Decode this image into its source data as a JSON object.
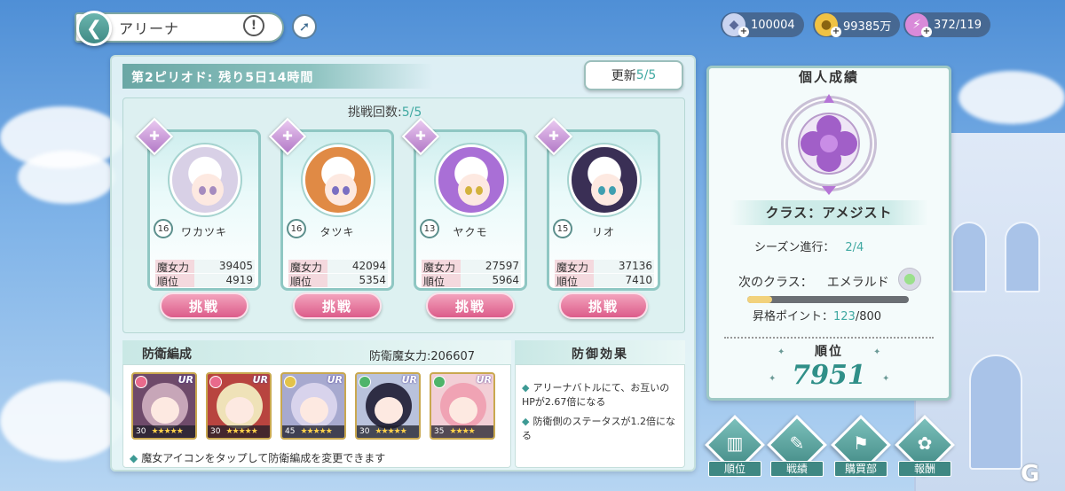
{
  "header": {
    "title": "アリーナ",
    "help_glyph": "!",
    "compass_glyph": "➚",
    "back_glyph": "❮"
  },
  "currencies": [
    {
      "name": "diamond-icon",
      "value": "100004",
      "color": "#c9d4f0"
    },
    {
      "name": "coin-icon",
      "value": "99385万",
      "color": "#f0c244"
    },
    {
      "name": "stamina-icon",
      "value": "372/119",
      "color": "#d98ad9"
    }
  ],
  "period": {
    "label": "第2ピリオド: 残り5日14時間"
  },
  "refresh": {
    "label": "更新",
    "count": "5/5"
  },
  "challenges": {
    "label": "挑戦回数:",
    "count": "5/5"
  },
  "opponents": [
    {
      "level": "16",
      "name": "ワカツキ",
      "power_label": "魔女力",
      "power": "39405",
      "rank_label": "順位",
      "rank": "4919",
      "hair": "#d8d0e6",
      "eye": "#a58bbf"
    },
    {
      "level": "16",
      "name": "タツキ",
      "power_label": "魔女力",
      "power": "42094",
      "rank_label": "順位",
      "rank": "5354",
      "hair": "#e08a45",
      "eye": "#7a6fc2"
    },
    {
      "level": "13",
      "name": "ヤクモ",
      "power_label": "魔女力",
      "power": "27597",
      "rank_label": "順位",
      "rank": "5964",
      "hair": "#a96fd6",
      "eye": "#d3b23c"
    },
    {
      "level": "15",
      "name": "リオ",
      "power_label": "魔女力",
      "power": "37136",
      "rank_label": "順位",
      "rank": "7410",
      "hair": "#3a2f55",
      "eye": "#3f9fb0"
    }
  ],
  "challenge_button": "挑戦",
  "defense": {
    "title": "防衛編成",
    "power": "防衛魔女力:206607",
    "note": "魔女アイコンをタップして防衛編成を変更できます",
    "heroes": [
      {
        "level": "30",
        "rarity": "UR",
        "stars": "★★★★★",
        "hair": "#c7a6b8",
        "bg": "#6e4a6a"
      },
      {
        "level": "30",
        "rarity": "UR",
        "stars": "★★★★★",
        "hair": "#efe2b8",
        "bg": "#b8443f"
      },
      {
        "level": "45",
        "rarity": "UR",
        "stars": "★★★★★",
        "hair": "#d8d3ec",
        "bg": "#a7a9cf"
      },
      {
        "level": "30",
        "rarity": "UR",
        "stars": "★★★★★",
        "hair": "#2e2d44",
        "bg": "#b9c2dc"
      },
      {
        "level": "35",
        "rarity": "UR",
        "stars": "★★★★",
        "hair": "#f0a3b4",
        "bg": "#f2cfd6"
      }
    ]
  },
  "effect": {
    "title": "防御効果",
    "items": [
      "アリーナバトルにて、お互いのHPが2.67倍になる",
      "防衛側のステータスが1.2倍になる"
    ]
  },
  "personal": {
    "title": "個人成績",
    "class_label": "クラス：アメジスト",
    "season_label": "シーズン進行：",
    "season_value": "2/4",
    "next_label": "次のクラス：",
    "next_value": "エメラルド",
    "points_label": "昇格ポイント：",
    "points_value": "123",
    "points_max": "/800",
    "progress": 0.154,
    "rank_label": "順位",
    "rank_value": "7951"
  },
  "nav": [
    {
      "name": "ranking",
      "label": "順位",
      "glyph": "▥"
    },
    {
      "name": "record",
      "label": "戦績",
      "glyph": "✎"
    },
    {
      "name": "shop",
      "label": "購買部",
      "glyph": "⚑"
    },
    {
      "name": "reward",
      "label": "報酬",
      "glyph": "✿"
    }
  ],
  "watermark": "G"
}
